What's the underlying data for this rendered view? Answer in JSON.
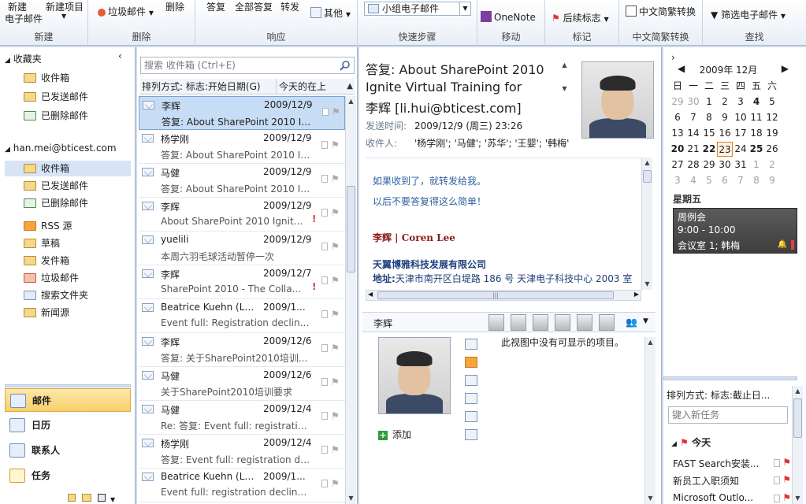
{
  "ribbon": {
    "new_group_items": [
      "新建",
      "新建项目",
      "电子邮件"
    ],
    "junk_label": "垃圾邮件",
    "delete_label": "删除",
    "respond_items": [
      "答复",
      "全部答复",
      "转发",
      "其他"
    ],
    "quick_step_value": "小组电子邮件",
    "onenote_label": "OneNote",
    "followup_label": "后续标志",
    "chinese_convert_label": "中文简繁转换",
    "filter_label": "筛选电子邮件",
    "group_labels": [
      "新建",
      "删除",
      "响应",
      "快速步骤",
      "移动",
      "标记",
      "中文简繁转换",
      "查找"
    ]
  },
  "nav": {
    "favorites_label": "收藏夹",
    "favorites": [
      "收件箱",
      "已发送邮件",
      "已删除邮件"
    ],
    "account_label": "han.mei@bticest.com",
    "account_items": [
      "收件箱",
      "已发送邮件",
      "已删除邮件",
      "RSS 源",
      "草稿",
      "发件箱",
      "垃圾邮件",
      "搜索文件夹",
      "新闻源"
    ],
    "buttons": [
      "邮件",
      "日历",
      "联系人",
      "任务"
    ]
  },
  "list": {
    "search_placeholder": "搜索 收件箱 (Ctrl+E)",
    "arrange_label": "排列方式: 标志:开始日期(G)",
    "arrange_group": "今天的在上",
    "messages": [
      {
        "from": "李辉",
        "date": "2009/12/9",
        "subject": "答复: About SharePoint 2010 Ig...",
        "selected": true,
        "important": false
      },
      {
        "from": "杨学刚",
        "date": "2009/12/9",
        "subject": "答复: About SharePoint 2010 Ig...",
        "selected": false,
        "important": false
      },
      {
        "from": "马健",
        "date": "2009/12/9",
        "subject": "答复: About SharePoint 2010 Ig...",
        "selected": false,
        "important": false
      },
      {
        "from": "李辉",
        "date": "2009/12/9",
        "subject": "About SharePoint 2010 Ignit...",
        "selected": false,
        "important": true
      },
      {
        "from": "yuelili",
        "date": "2009/12/9",
        "subject": "本周六羽毛球活动暂停一次",
        "selected": false,
        "important": false
      },
      {
        "from": "李辉",
        "date": "2009/12/7",
        "subject": "SharePoint 2010 - The Colla...",
        "selected": false,
        "important": true
      },
      {
        "from": "Beatrice Kuehn (LM IT)",
        "date": "2009/1...",
        "subject": "Event full: Registration decline...",
        "selected": false,
        "important": false
      },
      {
        "from": "李辉",
        "date": "2009/12/6",
        "subject": "答复: 关于SharePoint2010培训...",
        "selected": false,
        "important": false
      },
      {
        "from": "马健",
        "date": "2009/12/6",
        "subject": "关于SharePoint2010培训要求",
        "selected": false,
        "important": false
      },
      {
        "from": "马健",
        "date": "2009/12/4",
        "subject": "Re: 答复: Event full: registratio...",
        "selected": false,
        "important": false
      },
      {
        "from": "杨学刚",
        "date": "2009/12/4",
        "subject": "答复: Event full: registration de...",
        "selected": false,
        "important": false
      },
      {
        "from": "Beatrice Kuehn (LM IT)",
        "date": "2009/1...",
        "subject": "Event full: registration declined...",
        "selected": false,
        "important": false
      }
    ]
  },
  "reading": {
    "subject": "答复: About SharePoint 2010 Ignite Virtual Training for",
    "from": "李辉 [li.hui@bticest.com]",
    "sent_label": "发送时间:",
    "sent_value": "2009/12/9 (周三) 23:26",
    "to_label": "收件人:",
    "to_value": "'杨学刚'; '马健'; '苏华'; '王婴'; '韩梅'",
    "body_line1": "如果收到了，就转发给我。",
    "body_line2": "以后不要答复得这么简单！",
    "signature_name": "李辉 |  Coren Lee",
    "company": "天翼博雅科技发展有限公司",
    "address_label": "地址:",
    "address_value": "天津市南开区白堤路 186 号 天津电子科技中心 2003 室",
    "people_name": "李辉",
    "add_label": "添加",
    "empty_view": "此视图中没有可显示的项目。"
  },
  "todo": {
    "month_label": "2009年 12月",
    "weekdays": [
      "日",
      "一",
      "二",
      "三",
      "四",
      "五",
      "六"
    ],
    "weeks": [
      [
        "29",
        "30",
        "1",
        "2",
        "3",
        "4",
        "5"
      ],
      [
        "6",
        "7",
        "8",
        "9",
        "10",
        "11",
        "12"
      ],
      [
        "13",
        "14",
        "15",
        "16",
        "17",
        "18",
        "19"
      ],
      [
        "20",
        "21",
        "22",
        "23",
        "24",
        "25",
        "26"
      ],
      [
        "27",
        "28",
        "29",
        "30",
        "31",
        "1",
        "2"
      ],
      [
        "3",
        "4",
        "5",
        "6",
        "7",
        "8",
        "9"
      ]
    ],
    "appt_day": "星期五",
    "appt_title": "周例会",
    "appt_time": "9:00 - 10:00",
    "appt_place": "会议室 1; 韩梅",
    "task_arrange": "排列方式: 标志:截止日...",
    "task_input_placeholder": "键入新任务",
    "task_group": "今天",
    "tasks": [
      "FAST Search安装...",
      "新员工入职须知",
      "Microsoft Outlo..."
    ]
  },
  "colors": {
    "selection": "#c7dcf5",
    "accent_blue": "#1f5fa8",
    "link_blue": "#2f5fa0",
    "signature_red": "#8b1a1a"
  }
}
